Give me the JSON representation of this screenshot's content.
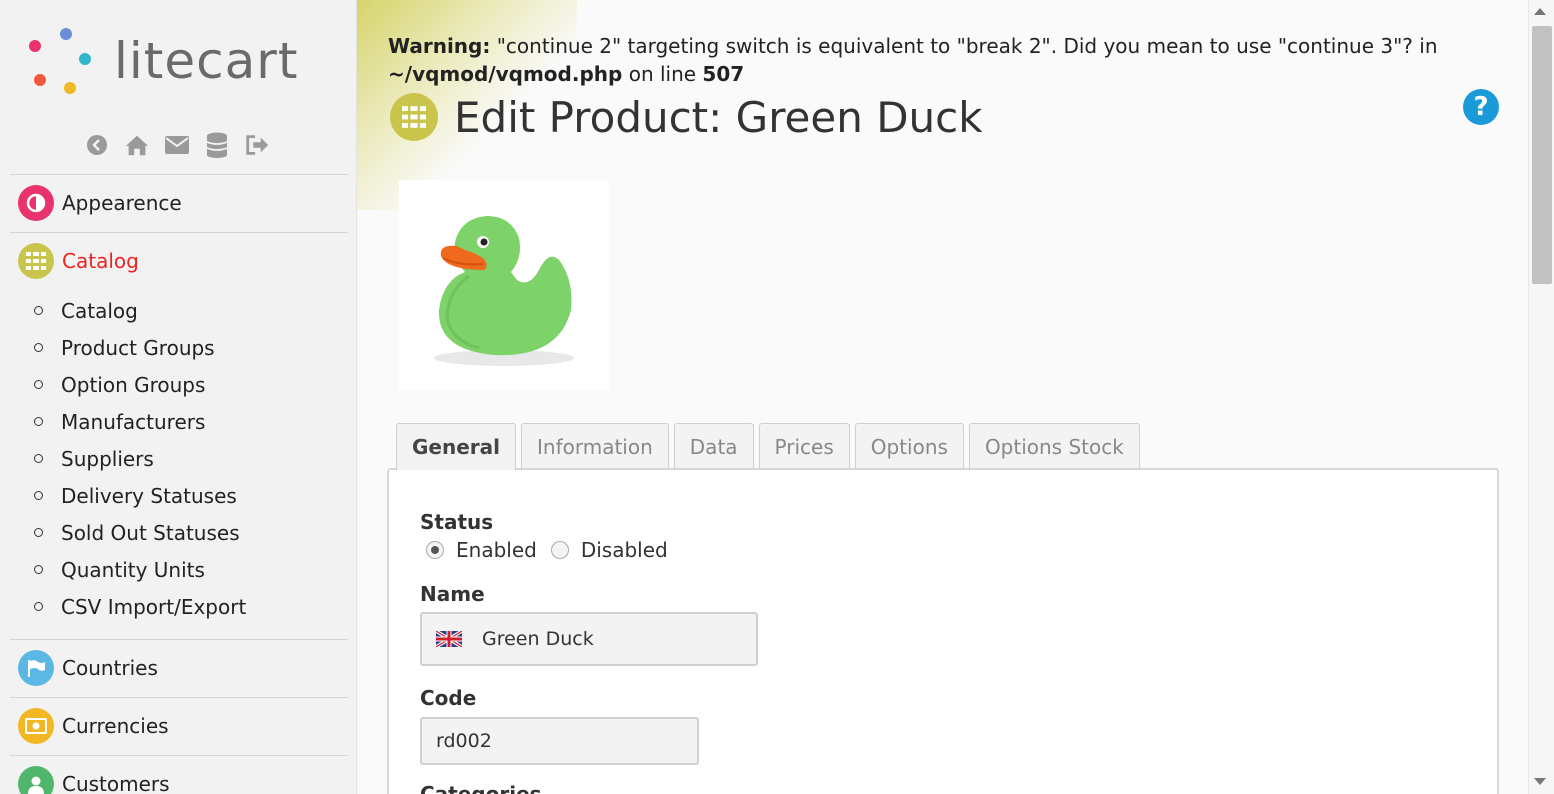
{
  "brand": {
    "name": "litecart"
  },
  "sidebar": {
    "quick_icons": [
      "back-icon",
      "home-icon",
      "mail-icon",
      "database-icon",
      "logout-icon"
    ],
    "apps": [
      {
        "label": "Appearence",
        "icon": "half-circle-icon",
        "color": "#e8336d"
      },
      {
        "label": "Catalog",
        "icon": "grid-icon",
        "color": "#c9c44c",
        "active": true
      },
      {
        "label": "Countries",
        "icon": "flag-icon",
        "color": "#5bb7e3"
      },
      {
        "label": "Currencies",
        "icon": "money-icon",
        "color": "#f2b824"
      },
      {
        "label": "Customers",
        "icon": "user-icon",
        "color": "#4fb66b"
      }
    ],
    "catalog_items": [
      "Catalog",
      "Product Groups",
      "Option Groups",
      "Manufacturers",
      "Suppliers",
      "Delivery Statuses",
      "Sold Out Statuses",
      "Quantity Units",
      "CSV Import/Export"
    ]
  },
  "warning": {
    "prefix": "Warning:",
    "message": " \"continue 2\" targeting switch is equivalent to \"break 2\". Did you mean to use \"continue 3\"? in ",
    "file": "~/vqmod/vqmod.php",
    "on_line": " on line ",
    "line": "507"
  },
  "page": {
    "title": "Edit Product: Green Duck",
    "help": "?"
  },
  "tabs": [
    "General",
    "Information",
    "Data",
    "Prices",
    "Options",
    "Options Stock"
  ],
  "form": {
    "status_label": "Status",
    "status_options": [
      "Enabled",
      "Disabled"
    ],
    "status_selected": "Enabled",
    "name_label": "Name",
    "name_value": "Green Duck",
    "code_label": "Code",
    "code_value": "rd002",
    "categories_label": "Categories"
  }
}
